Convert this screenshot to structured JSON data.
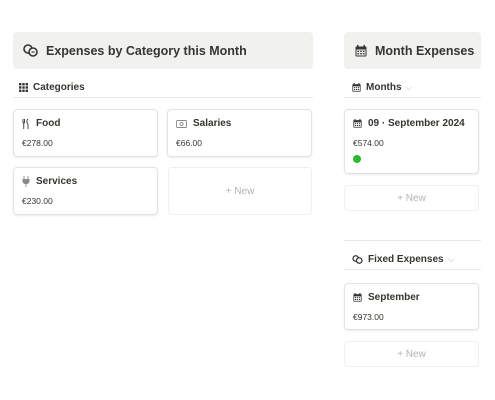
{
  "left_panel": {
    "title": "Expenses by Category this Month",
    "title_icon": "coins-icon",
    "view_label": "Categories",
    "view_icon": "grid-icon",
    "cards": [
      {
        "title": "Food",
        "icon": "fork-knife-icon",
        "amount": "€278.00"
      },
      {
        "title": "Salaries",
        "icon": "money-bill-icon",
        "amount": "€66.00"
      },
      {
        "title": "Services",
        "icon": "plug-icon",
        "amount": "€230.00"
      }
    ],
    "new_label": "+ New"
  },
  "right_panel": {
    "title": "Month Expenses",
    "title_icon": "calendar-icon",
    "months_view": {
      "label": "Months",
      "icon": "calendar-icon",
      "card": {
        "title": "09 · September 2024",
        "amount": "€574.00",
        "status_color": "#2db82d"
      },
      "new_label": "+ New"
    },
    "fixed_view": {
      "label": "Fixed Expenses",
      "icon": "coins-icon",
      "card": {
        "title": "September",
        "amount": "€973.00"
      },
      "new_label": "+ New"
    }
  },
  "colors": {
    "header_bg": "#f1f1ef",
    "text": "#37352f",
    "muted": "#b4b3b0",
    "status_green": "#2db82d"
  }
}
